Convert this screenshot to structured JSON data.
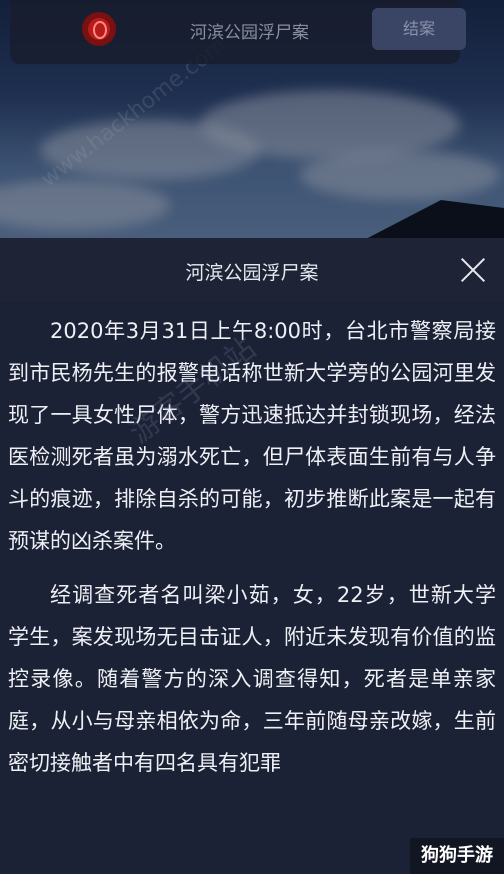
{
  "topbar": {
    "title": "河滨公园浮尸案",
    "close_case_label": "结案"
  },
  "watermarks": {
    "top": "www.hackhome.com",
    "body": "游客手机站",
    "corner": "狗狗手游"
  },
  "modal": {
    "title": "河滨公园浮尸案",
    "paragraphs": [
      "2020年3月31日上午8:00时，台北市警察局接到市民杨先生的报警电话称世新大学旁的公园河里发现了一具女性尸体，警方迅速抵达并封锁现场，经法医检测死者虽为溺水死亡，但尸体表面生前有与人争斗的痕迹，排除自杀的可能，初步推断此案是一起有预谋的凶杀案件。",
      "经调查死者名叫梁小茹，女，22岁，世新大学学生，案发现场无目击证人，附近未发现有价值的监控录像。随着警方的深入调查得知，死者是单亲家庭，从小与母亲相依为命，三年前随母亲改嫁，生前密切接触者中有四名具有犯罪"
    ]
  }
}
